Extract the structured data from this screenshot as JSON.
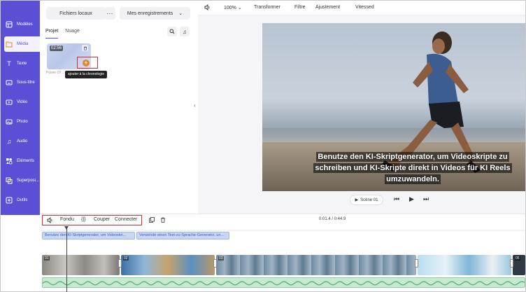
{
  "nav": {
    "items": [
      {
        "label": "Modèles",
        "icon": "templates-icon"
      },
      {
        "label": "Média",
        "icon": "folder-icon",
        "active": true
      },
      {
        "label": "Texte",
        "icon": "text-icon"
      },
      {
        "label": "Sous-titre",
        "icon": "subtitle-icon"
      },
      {
        "label": "Vidéo",
        "icon": "video-icon"
      },
      {
        "label": "Photo",
        "icon": "photo-icon"
      },
      {
        "label": "Audio",
        "icon": "audio-icon"
      },
      {
        "label": "Eléments",
        "icon": "elements-icon"
      },
      {
        "label": "Superposi...",
        "icon": "overlay-icon"
      },
      {
        "label": "Outils",
        "icon": "tools-icon"
      }
    ]
  },
  "media": {
    "local_files": "Fichiers locaux",
    "more": "···",
    "records": "Mes enregistrements",
    "tabs": [
      "Projet",
      "Nuage"
    ],
    "thumb": {
      "duration": "02:56",
      "name": "Power Of ..."
    },
    "add_icon": "+",
    "tooltip": "ajouter à la chronologie"
  },
  "toolbar": {
    "zoom": "100%",
    "items": [
      "Transformer",
      "Filtre",
      "Ajustement",
      "Vitessed"
    ]
  },
  "preview": {
    "subtitle": "Benutze den KI-Skriptgenerator, um Videoskripte zu schreiben und KI-Skripte direkt in Videos für KI Reels umzuwandeln.",
    "scene": "Scène 01"
  },
  "timeline": {
    "tools": [
      "Fondu",
      "Couper",
      "Connecter"
    ],
    "timecode": "0:01.4 / 0:44.9",
    "text_clips": [
      "Benutze den KI-Skriptgenerator, um Videoskri...",
      "Verwende einen Text-zu-Sprache-Generator, un..."
    ],
    "clip_labels": [
      "01",
      "02",
      "03",
      "05"
    ]
  },
  "colors": {
    "nav_bg": "#5b4fd6",
    "highlight": "#e0262d",
    "accent": "#5b4fd6"
  }
}
